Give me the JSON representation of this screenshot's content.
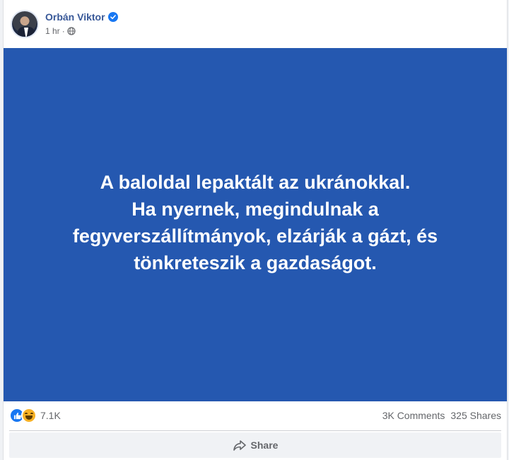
{
  "post": {
    "author": "Orbán Viktor",
    "time": "1 hr",
    "separator": "·",
    "image_text": "A baloldal lepaktált az ukránokkal.\nHa nyernek, megindulnak a\nfegyverszállítmányok, elzárják a gázt, és\ntönkreteszik a gazdaságot.",
    "reactions_count": "7.1K",
    "comments": "3K Comments",
    "shares": "325 Shares",
    "share_label": "Share"
  },
  "colors": {
    "image_bg": "#2558b0",
    "author": "#385898",
    "verified": "#1877f2"
  },
  "icons": [
    "avatar",
    "verified-icon",
    "globe-icon",
    "like-reaction-icon",
    "haha-reaction-icon",
    "share-arrow-icon"
  ]
}
